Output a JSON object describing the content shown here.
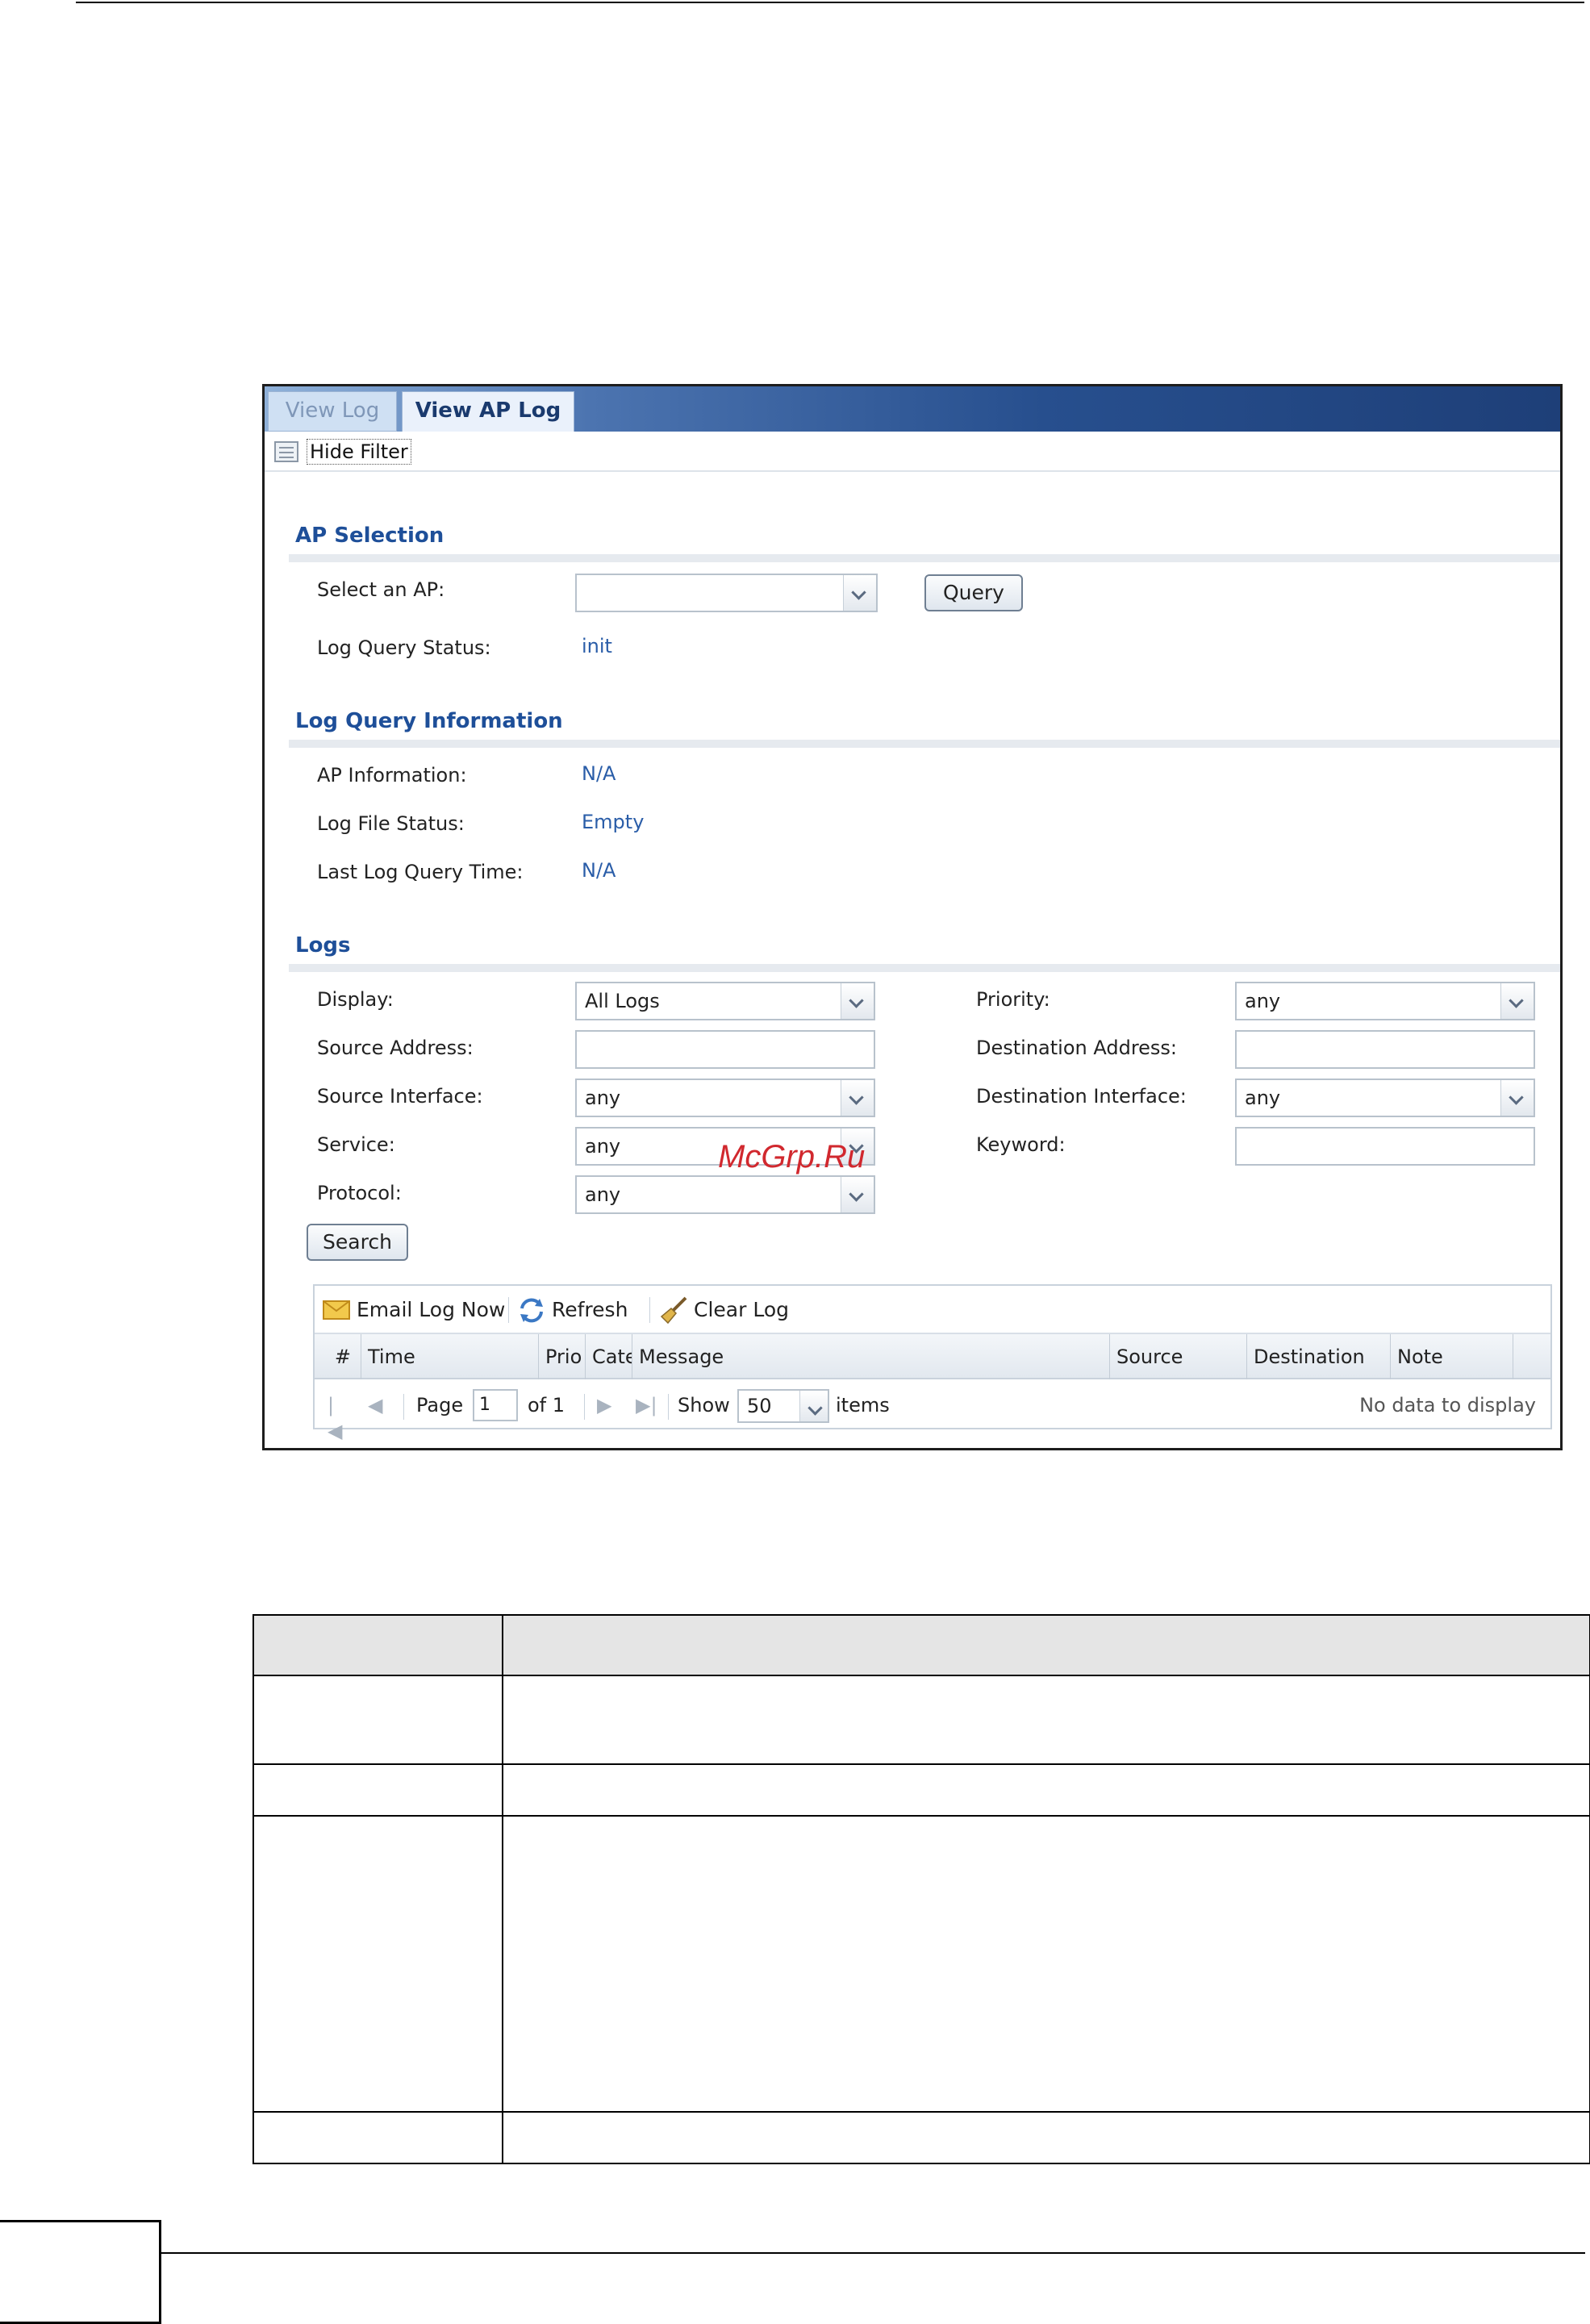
{
  "tabs": [
    {
      "label": "View Log",
      "active": false
    },
    {
      "label": "View AP Log",
      "active": true
    }
  ],
  "filter_toggle": {
    "label": "Hide Filter"
  },
  "ap_selection": {
    "heading": "AP Selection",
    "select_ap_label": "Select an AP:",
    "select_ap_value": "",
    "query_button": "Query",
    "status_label": "Log Query Status:",
    "status_value": "init"
  },
  "log_query_info": {
    "heading": "Log Query Information",
    "ap_info_label": "AP Information:",
    "ap_info_value": "N/A",
    "file_status_label": "Log File Status:",
    "file_status_value": "Empty",
    "last_time_label": "Last Log Query Time:",
    "last_time_value": "N/A"
  },
  "logs": {
    "heading": "Logs",
    "display_label": "Display:",
    "display_value": "All Logs",
    "priority_label": "Priority:",
    "priority_value": "any",
    "source_address_label": "Source Address:",
    "source_address_value": "",
    "destination_address_label": "Destination Address:",
    "destination_address_value": "",
    "source_interface_label": "Source Interface:",
    "source_interface_value": "any",
    "destination_interface_label": "Destination Interface:",
    "destination_interface_value": "any",
    "service_label": "Service:",
    "service_value": "any",
    "keyword_label": "Keyword:",
    "keyword_value": "",
    "protocol_label": "Protocol:",
    "protocol_value": "any",
    "search_button": "Search"
  },
  "grid": {
    "toolbar": {
      "email": "Email Log Now",
      "refresh": "Refresh",
      "clear": "Clear Log"
    },
    "columns": [
      "#",
      "Time",
      "Prio",
      "Cate",
      "Message",
      "Source",
      "Destination",
      "Note"
    ],
    "pager": {
      "page_label": "Page",
      "page_value": "1",
      "of_label": "of 1",
      "show_label": "Show",
      "show_value": "50",
      "items_label": "items",
      "empty_text": "No data to display"
    }
  },
  "watermark": "McGrp.Ru",
  "colors": {
    "section_heading": "#1e4f99",
    "value_text": "#2a5da8",
    "tabbar": "#274f8e",
    "watermark": "#d1282e"
  }
}
